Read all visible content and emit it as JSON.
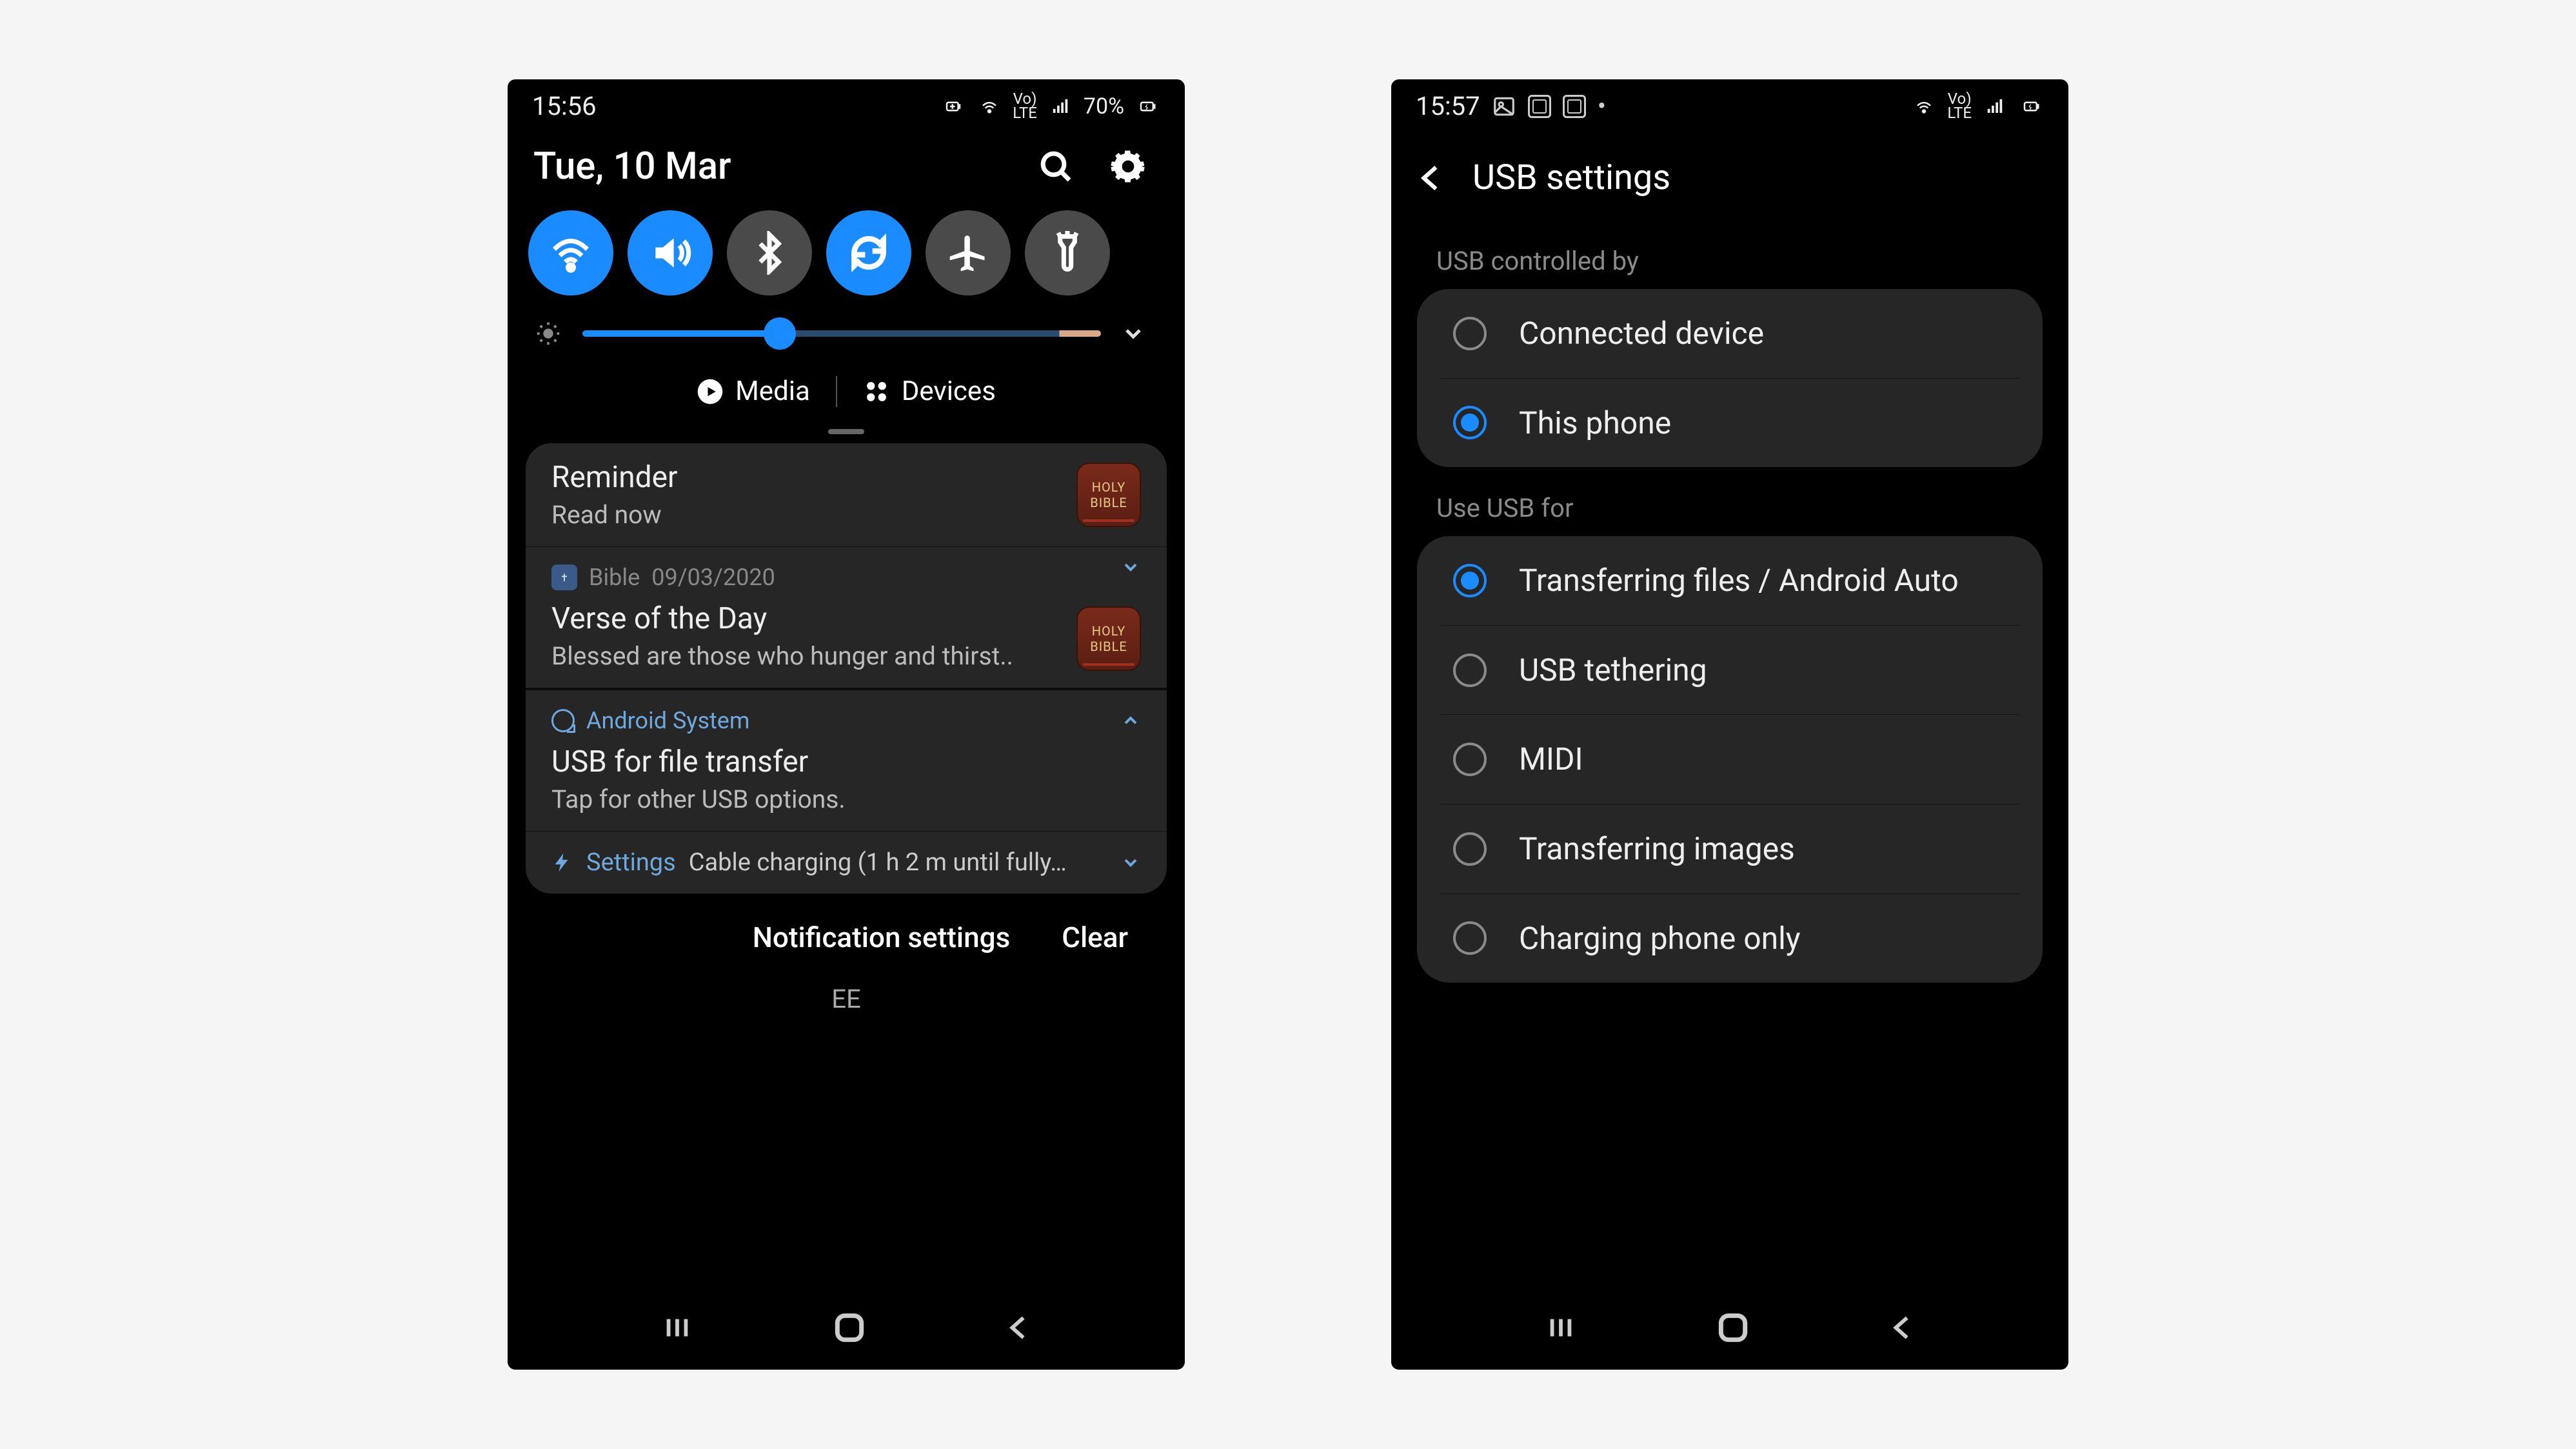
{
  "left": {
    "status": {
      "time": "15:56",
      "battery": "70%",
      "volte": "Vo)\nLTE"
    },
    "date": "Tue, 10 Mar",
    "toggles": {
      "wifi": true,
      "sound": true,
      "bluetooth": false,
      "sync": true,
      "airplane": false,
      "torch": false
    },
    "brightness_pct": 38,
    "media_label": "Media",
    "devices_label": "Devices",
    "notifications": [
      {
        "type": "reminder",
        "title": "Reminder",
        "body": "Read now"
      },
      {
        "type": "bible",
        "app": "Bible",
        "date": "09/03/2020",
        "title": "Verse of the Day",
        "body": "Blessed are those who hunger and thirst.."
      },
      {
        "type": "usb",
        "app": "Android System",
        "title": "USB for file transfer",
        "body": "Tap for other USB options."
      },
      {
        "type": "charging",
        "app": "Settings",
        "body": "Cable charging (1 h 2 m until fully…"
      }
    ],
    "footer": {
      "settings": "Notification settings",
      "clear": "Clear"
    },
    "carrier": "EE"
  },
  "right": {
    "status": {
      "time": "15:57"
    },
    "page_title": "USB settings",
    "section1": {
      "label": "USB controlled by",
      "options": [
        {
          "label": "Connected device",
          "checked": false
        },
        {
          "label": "This phone",
          "checked": true
        }
      ]
    },
    "section2": {
      "label": "Use USB for",
      "options": [
        {
          "label": "Transferring files / Android Auto",
          "checked": true
        },
        {
          "label": "USB tethering",
          "checked": false
        },
        {
          "label": "MIDI",
          "checked": false
        },
        {
          "label": "Transferring images",
          "checked": false
        },
        {
          "label": "Charging phone only",
          "checked": false
        }
      ]
    }
  }
}
